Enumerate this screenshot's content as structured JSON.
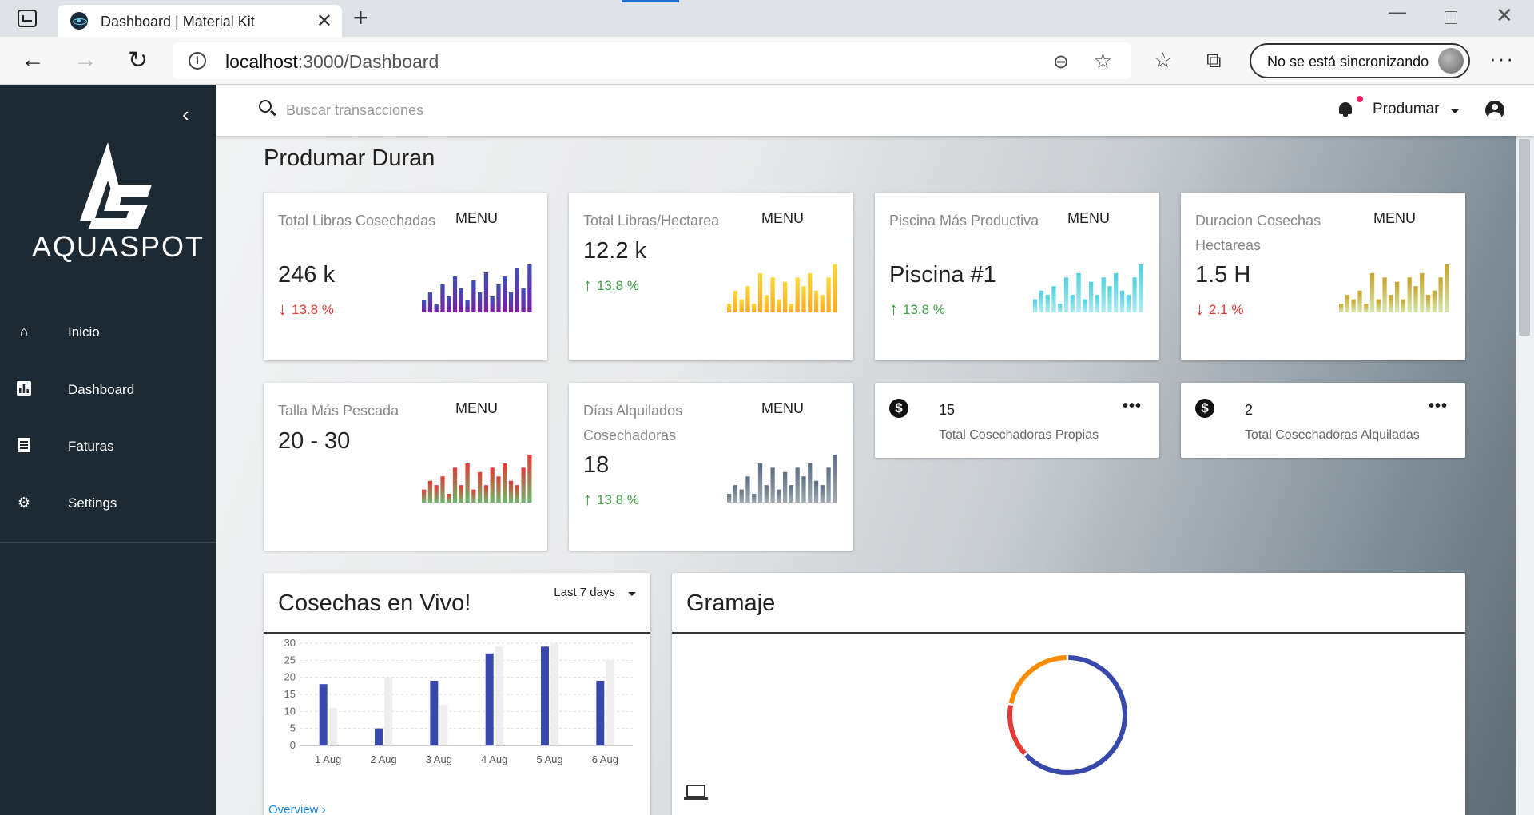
{
  "browser": {
    "tab_title": "Dashboard | Material Kit",
    "url_host": "localhost",
    "url_path": ":3000/Dashboard",
    "sync_label": "No se está sincronizando"
  },
  "sidebar": {
    "logo_text": "AQUASPOT",
    "items": [
      {
        "label": "Inicio",
        "icon": "home-icon"
      },
      {
        "label": "Dashboard",
        "icon": "chart-icon"
      },
      {
        "label": "Faturas",
        "icon": "receipt-icon"
      },
      {
        "label": "Settings",
        "icon": "gear-icon"
      }
    ]
  },
  "topbar": {
    "search_placeholder": "Buscar transacciones",
    "user_name": "Produmar"
  },
  "page_title": "Produmar Duran",
  "stat_cards": [
    {
      "title": "Total Libras Cosechadas",
      "menu": "MENU",
      "value": "246 k",
      "delta": "13.8 %",
      "trend": "down",
      "colors": [
        "#3f51b5",
        "#7b1fa2"
      ],
      "bars": [
        3,
        5,
        2,
        7,
        4,
        9,
        6,
        3,
        8,
        5,
        10,
        4,
        7,
        9,
        5,
        11,
        6,
        12
      ]
    },
    {
      "title": "Total Libras/Hectarea",
      "menu": "MENU",
      "value": "12.2 k",
      "delta": "13.8 %",
      "trend": "up",
      "colors": [
        "#fdd835",
        "#f9a825"
      ],
      "bars": [
        2,
        5,
        3,
        6,
        2,
        9,
        4,
        8,
        3,
        7,
        2,
        8,
        6,
        9,
        5,
        4,
        8,
        11
      ]
    },
    {
      "title": "Piscina Más Productiva",
      "menu": "MENU",
      "value": "Piscina #1",
      "delta": "13.8 %",
      "trend": "up",
      "colors": [
        "#4dd0e1",
        "#b2ebf2"
      ],
      "bars": [
        3,
        5,
        4,
        6,
        2,
        8,
        4,
        9,
        3,
        7,
        4,
        8,
        6,
        9,
        5,
        4,
        8,
        11
      ]
    },
    {
      "title": "Duracion Cosechas Hectareas",
      "menu": "MENU",
      "value": "1.5 H",
      "delta": "2.1 %",
      "trend": "down",
      "colors": [
        "#c9a227",
        "#d4e8b0"
      ],
      "bars": [
        2,
        4,
        3,
        5,
        2,
        9,
        3,
        8,
        4,
        7,
        3,
        8,
        6,
        9,
        4,
        5,
        8,
        11
      ]
    },
    {
      "title": "Talla Más Pescada",
      "menu": "MENU",
      "value": "20 - 30",
      "delta": "",
      "trend": "",
      "colors": [
        "#e53935",
        "#66bb6a"
      ],
      "bars": [
        3,
        5,
        4,
        6,
        2,
        8,
        4,
        9,
        3,
        7,
        4,
        8,
        6,
        9,
        5,
        4,
        8,
        11
      ]
    },
    {
      "title": "Días Alquilados Cosechadoras",
      "menu": "MENU",
      "value": "18",
      "delta": "13.8 %",
      "trend": "up",
      "colors": [
        "#5c6f82",
        "#a0aab4"
      ],
      "bars": [
        2,
        4,
        3,
        6,
        2,
        9,
        4,
        8,
        3,
        7,
        4,
        8,
        6,
        9,
        5,
        4,
        8,
        11
      ]
    }
  ],
  "small_cards": [
    {
      "value": "15",
      "label": "Total Cosechadoras Propias"
    },
    {
      "value": "2",
      "label": "Total Cosechadoras Alquiladas"
    }
  ],
  "live_panel": {
    "title": "Cosechas en Vivo!",
    "range": "Last 7 days",
    "link": "Overview"
  },
  "chart_data": {
    "type": "bar",
    "categories": [
      "1 Aug",
      "2 Aug",
      "3 Aug",
      "4 Aug",
      "5 Aug",
      "6 Aug"
    ],
    "series": [
      {
        "values": [
          18,
          5,
          19,
          27,
          29,
          19
        ],
        "color": "#3949ab"
      },
      {
        "values": [
          11,
          20,
          12,
          29,
          30,
          25
        ],
        "color": "#eeeeee"
      }
    ],
    "yticks": [
      "0",
      "5",
      "10",
      "15",
      "20",
      "25",
      "30"
    ],
    "ylim": [
      0,
      30
    ],
    "grid": true
  },
  "gramaje_panel": {
    "title": "Gramaje",
    "donut": [
      {
        "value": 63,
        "color": "#3949ab"
      },
      {
        "value": 15,
        "color": "#e53935"
      },
      {
        "value": 22,
        "color": "#fb8c00"
      }
    ]
  }
}
